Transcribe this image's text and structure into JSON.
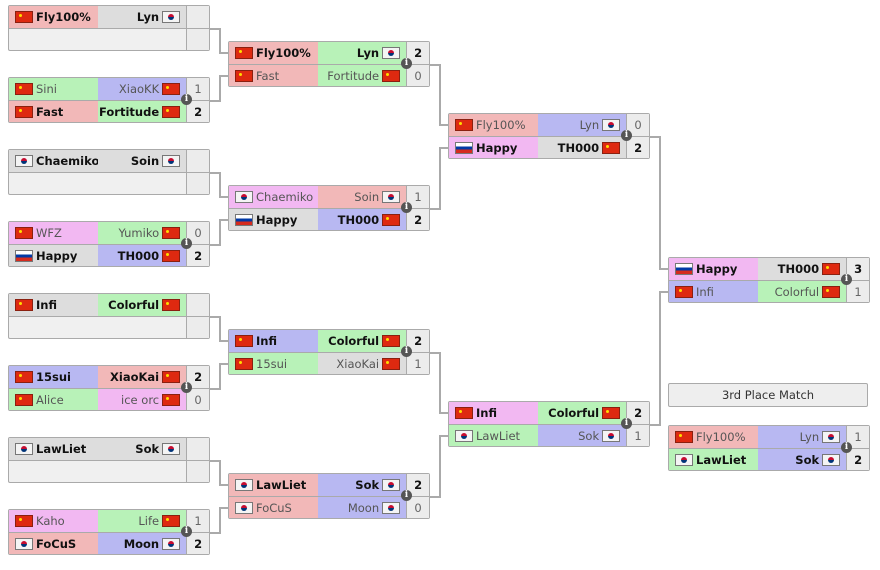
{
  "colors": {
    "red": "#f2b8b8",
    "green": "#b8f2b8",
    "blue": "#b8b8f2",
    "pink": "#f2b8f2",
    "grey": "#dddddd"
  },
  "third_place_label": "3rd Place Match",
  "rounds": [
    [
      {
        "rows": [
          {
            "l": {
              "name": "Fly100%",
              "flag": "cn",
              "color": "red"
            },
            "r": {
              "name": "Lyn",
              "flag": "kr",
              "color": "grey"
            },
            "score": "",
            "win": true
          },
          null
        ]
      },
      {
        "rows": [
          {
            "l": {
              "name": "Sini",
              "flag": "cn",
              "color": "green"
            },
            "r": {
              "name": "XiaoKK",
              "flag": "cn",
              "color": "blue"
            },
            "score": "1",
            "win": false
          },
          {
            "l": {
              "name": "Fast",
              "flag": "cn",
              "color": "red"
            },
            "r": {
              "name": "Fortitude",
              "flag": "cn",
              "color": "green"
            },
            "score": "2",
            "win": true
          }
        ]
      },
      {
        "rows": [
          {
            "l": {
              "name": "Chaemiko",
              "flag": "kr",
              "color": "grey"
            },
            "r": {
              "name": "Soin",
              "flag": "kr",
              "color": "grey"
            },
            "score": "",
            "win": true
          },
          null
        ]
      },
      {
        "rows": [
          {
            "l": {
              "name": "WFZ",
              "flag": "cn",
              "color": "pink"
            },
            "r": {
              "name": "Yumiko",
              "flag": "cn",
              "color": "green"
            },
            "score": "0",
            "win": false
          },
          {
            "l": {
              "name": "Happy",
              "flag": "ru",
              "color": "grey"
            },
            "r": {
              "name": "TH000",
              "flag": "cn",
              "color": "blue"
            },
            "score": "2",
            "win": true
          }
        ]
      },
      {
        "rows": [
          {
            "l": {
              "name": "Infi",
              "flag": "cn",
              "color": "grey"
            },
            "r": {
              "name": "Colorful",
              "flag": "cn",
              "color": "green"
            },
            "score": "",
            "win": true
          },
          null
        ]
      },
      {
        "rows": [
          {
            "l": {
              "name": "15sui",
              "flag": "cn",
              "color": "blue"
            },
            "r": {
              "name": "XiaoKai",
              "flag": "cn",
              "color": "red"
            },
            "score": "2",
            "win": true
          },
          {
            "l": {
              "name": "Alice",
              "flag": "cn",
              "color": "green"
            },
            "r": {
              "name": "ice orc",
              "flag": "cn",
              "color": "pink"
            },
            "score": "0",
            "win": false
          }
        ]
      },
      {
        "rows": [
          {
            "l": {
              "name": "LawLiet",
              "flag": "kr",
              "color": "grey"
            },
            "r": {
              "name": "Sok",
              "flag": "kr",
              "color": "grey"
            },
            "score": "",
            "win": true
          },
          null
        ]
      },
      {
        "rows": [
          {
            "l": {
              "name": "Kaho",
              "flag": "cn",
              "color": "pink"
            },
            "r": {
              "name": "Life",
              "flag": "cn",
              "color": "green"
            },
            "score": "1",
            "win": false
          },
          {
            "l": {
              "name": "FoCuS",
              "flag": "kr",
              "color": "red"
            },
            "r": {
              "name": "Moon",
              "flag": "kr",
              "color": "blue"
            },
            "score": "2",
            "win": true
          }
        ]
      }
    ],
    [
      {
        "rows": [
          {
            "l": {
              "name": "Fly100%",
              "flag": "cn",
              "color": "red"
            },
            "r": {
              "name": "Lyn",
              "flag": "kr",
              "color": "green"
            },
            "score": "2",
            "win": true
          },
          {
            "l": {
              "name": "Fast",
              "flag": "cn",
              "color": "red"
            },
            "r": {
              "name": "Fortitude",
              "flag": "cn",
              "color": "green"
            },
            "score": "0",
            "win": false
          }
        ]
      },
      {
        "rows": [
          {
            "l": {
              "name": "Chaemiko",
              "flag": "kr",
              "color": "pink"
            },
            "r": {
              "name": "Soin",
              "flag": "kr",
              "color": "red"
            },
            "score": "1",
            "win": false
          },
          {
            "l": {
              "name": "Happy",
              "flag": "ru",
              "color": "grey"
            },
            "r": {
              "name": "TH000",
              "flag": "cn",
              "color": "blue"
            },
            "score": "2",
            "win": true
          }
        ]
      },
      {
        "rows": [
          {
            "l": {
              "name": "Infi",
              "flag": "cn",
              "color": "blue"
            },
            "r": {
              "name": "Colorful",
              "flag": "cn",
              "color": "green"
            },
            "score": "2",
            "win": true
          },
          {
            "l": {
              "name": "15sui",
              "flag": "cn",
              "color": "green"
            },
            "r": {
              "name": "XiaoKai",
              "flag": "cn",
              "color": "grey"
            },
            "score": "1",
            "win": false
          }
        ]
      },
      {
        "rows": [
          {
            "l": {
              "name": "LawLiet",
              "flag": "kr",
              "color": "red"
            },
            "r": {
              "name": "Sok",
              "flag": "kr",
              "color": "blue"
            },
            "score": "2",
            "win": true
          },
          {
            "l": {
              "name": "FoCuS",
              "flag": "kr",
              "color": "red"
            },
            "r": {
              "name": "Moon",
              "flag": "kr",
              "color": "blue"
            },
            "score": "0",
            "win": false
          }
        ]
      }
    ],
    [
      {
        "rows": [
          {
            "l": {
              "name": "Fly100%",
              "flag": "cn",
              "color": "red"
            },
            "r": {
              "name": "Lyn",
              "flag": "kr",
              "color": "blue"
            },
            "score": "0",
            "win": false
          },
          {
            "l": {
              "name": "Happy",
              "flag": "ru",
              "color": "pink"
            },
            "r": {
              "name": "TH000",
              "flag": "cn",
              "color": "grey"
            },
            "score": "2",
            "win": true
          }
        ]
      },
      {
        "rows": [
          {
            "l": {
              "name": "Infi",
              "flag": "cn",
              "color": "pink"
            },
            "r": {
              "name": "Colorful",
              "flag": "cn",
              "color": "green"
            },
            "score": "2",
            "win": true
          },
          {
            "l": {
              "name": "LawLiet",
              "flag": "kr",
              "color": "green"
            },
            "r": {
              "name": "Sok",
              "flag": "kr",
              "color": "blue"
            },
            "score": "1",
            "win": false
          }
        ]
      }
    ],
    [
      {
        "rows": [
          {
            "l": {
              "name": "Happy",
              "flag": "ru",
              "color": "pink"
            },
            "r": {
              "name": "TH000",
              "flag": "cn",
              "color": "grey"
            },
            "score": "3",
            "win": true
          },
          {
            "l": {
              "name": "Infi",
              "flag": "cn",
              "color": "blue"
            },
            "r": {
              "name": "Colorful",
              "flag": "cn",
              "color": "green"
            },
            "score": "1",
            "win": false
          }
        ]
      }
    ],
    [
      {
        "rows": [
          {
            "l": {
              "name": "Fly100%",
              "flag": "cn",
              "color": "red"
            },
            "r": {
              "name": "Lyn",
              "flag": "kr",
              "color": "blue"
            },
            "score": "1",
            "win": false
          },
          {
            "l": {
              "name": "LawLiet",
              "flag": "kr",
              "color": "green"
            },
            "r": {
              "name": "Sok",
              "flag": "kr",
              "color": "blue"
            },
            "score": "2",
            "win": true
          }
        ]
      }
    ]
  ]
}
